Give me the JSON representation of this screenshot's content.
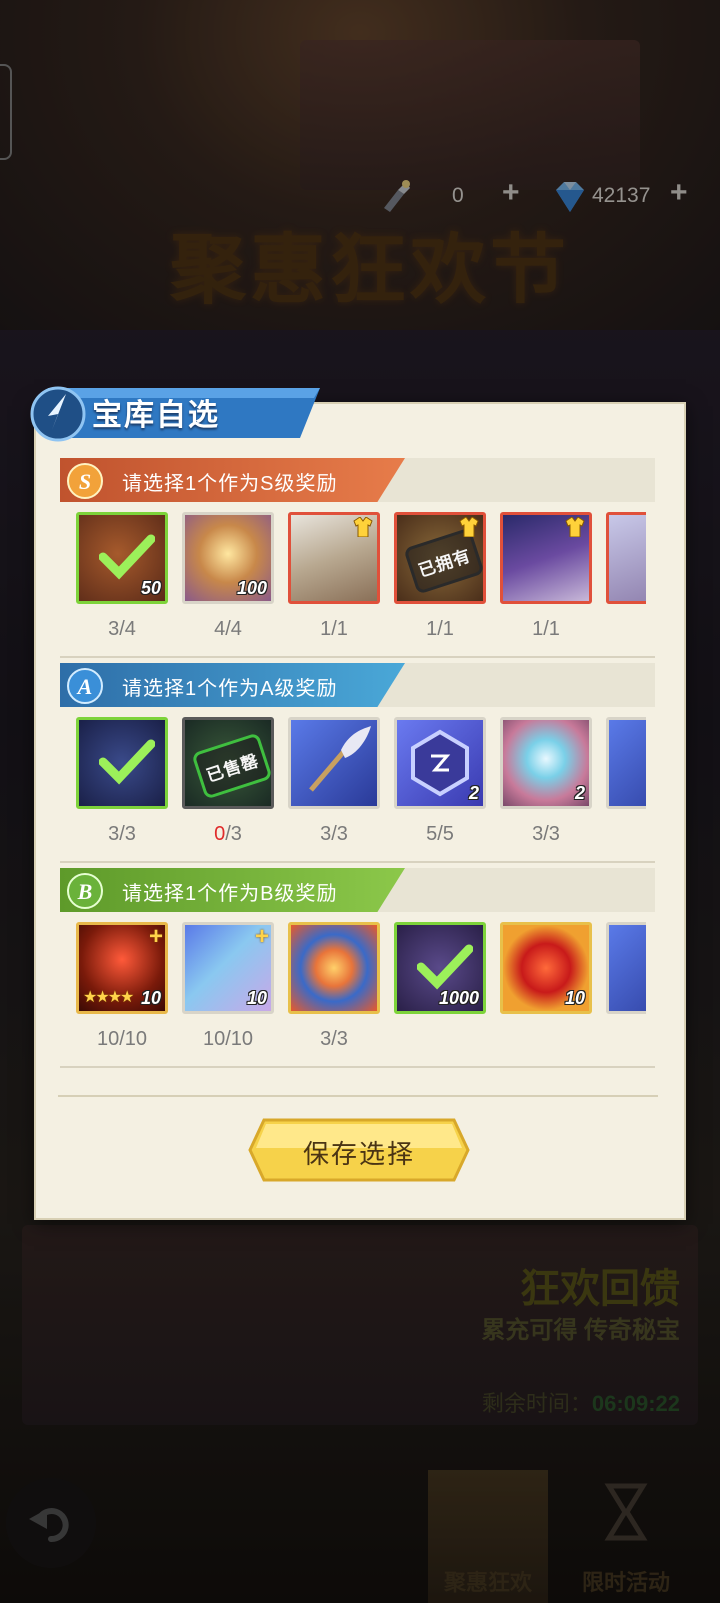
{
  "topbar": {
    "torch_icon": "torch-icon",
    "torch_count": "0",
    "diamond_icon": "diamond-icon",
    "diamond_count": "42137",
    "plus": "+"
  },
  "background": {
    "festival_title": "聚惠狂欢节",
    "banner_title": "狂欢回馈",
    "banner_subtitle": "累充可得 传奇秘宝",
    "remaining_label": "剩余时间：",
    "remaining_value": "06:09:22"
  },
  "bottom_nav": {
    "tabs": [
      {
        "label": "聚惠狂欢",
        "active": true
      },
      {
        "label": "限时活动",
        "active": false
      }
    ]
  },
  "modal": {
    "title": "宝库自选",
    "save_label": "保存选择",
    "sections": [
      {
        "badge": "S",
        "label": "请选择1个作为S级奖励",
        "color": "#d9643a",
        "items": [
          {
            "name": "treasure-chest",
            "qty": "50",
            "count": "3/4",
            "selected": true
          },
          {
            "name": "gold-cube",
            "qty": "100",
            "count": "4/4"
          },
          {
            "name": "hero-portrait-white-hair",
            "count": "1/1",
            "skin": true
          },
          {
            "name": "owned-hero",
            "stamp": "已拥有",
            "count": "1/1",
            "skin": true
          },
          {
            "name": "hero-portrait-purple-hair",
            "count": "1/1",
            "skin": true
          }
        ]
      },
      {
        "badge": "A",
        "label": "请选择1个作为A级奖励",
        "color": "#3a8fc0",
        "items": [
          {
            "name": "chain-weapon",
            "count": "3/3",
            "selected": true
          },
          {
            "name": "sold-out-item",
            "stamp": "已售罄",
            "count_num": "0",
            "count_den": "/3"
          },
          {
            "name": "feather-staff",
            "count": "3/3"
          },
          {
            "name": "rune-crystal",
            "qty": "2",
            "count": "5/5"
          },
          {
            "name": "orb-ornament",
            "qty": "2",
            "count": "3/3"
          }
        ]
      },
      {
        "badge": "B",
        "label": "请选择1个作为B级奖励",
        "color": "#78b23a",
        "items": [
          {
            "name": "star-shard",
            "stars": "★★★★",
            "qty": "10",
            "count": "10/10"
          },
          {
            "name": "prism-crystal",
            "qty": "10",
            "count": "10/10"
          },
          {
            "name": "blue-chest",
            "count": "3/3"
          },
          {
            "name": "ore-stone",
            "qty": "1000",
            "count": "",
            "selected": true
          },
          {
            "name": "red-gem",
            "qty": "10",
            "count": ""
          }
        ]
      }
    ]
  }
}
